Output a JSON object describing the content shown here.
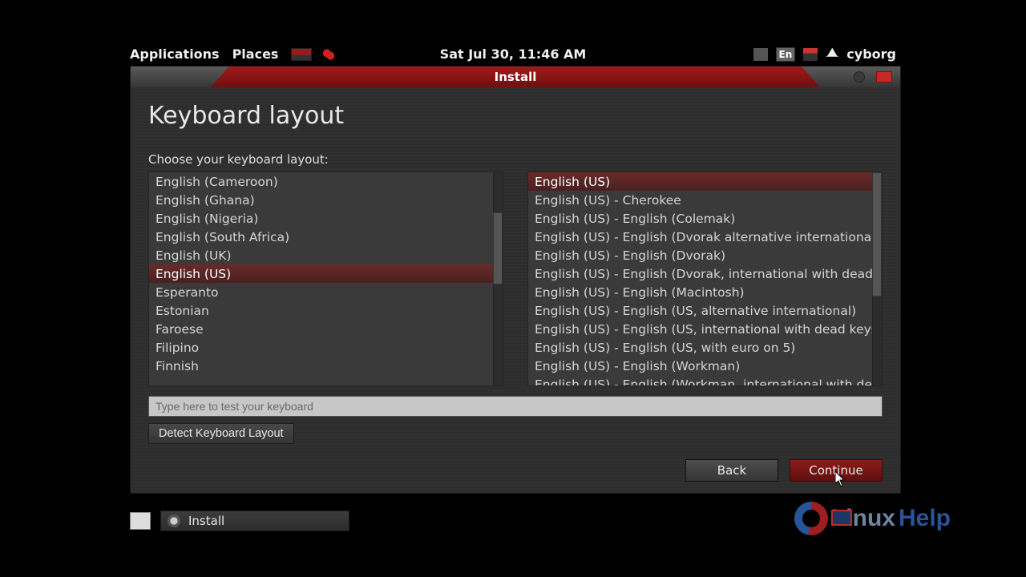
{
  "panel": {
    "menu_apps": "Applications",
    "menu_places": "Places",
    "clock": "Sat Jul 30, 11:46 AM",
    "lang_badge": "En",
    "user": "cyborg"
  },
  "window": {
    "title": "Install"
  },
  "page": {
    "title": "Keyboard layout",
    "choose_label": "Choose your keyboard layout:",
    "test_placeholder": "Type here to test your keyboard",
    "detect_label": "Detect Keyboard Layout",
    "back_label": "Back",
    "continue_label": "Continue"
  },
  "layouts_left": [
    {
      "label": "English (Cameroon)",
      "selected": false
    },
    {
      "label": "English (Ghana)",
      "selected": false
    },
    {
      "label": "English (Nigeria)",
      "selected": false
    },
    {
      "label": "English (South Africa)",
      "selected": false
    },
    {
      "label": "English (UK)",
      "selected": false
    },
    {
      "label": "English (US)",
      "selected": true
    },
    {
      "label": "Esperanto",
      "selected": false
    },
    {
      "label": "Estonian",
      "selected": false
    },
    {
      "label": "Faroese",
      "selected": false
    },
    {
      "label": "Filipino",
      "selected": false
    },
    {
      "label": "Finnish",
      "selected": false
    }
  ],
  "layouts_right": [
    {
      "label": "English (US)",
      "selected": true
    },
    {
      "label": "English (US) - Cherokee",
      "selected": false
    },
    {
      "label": "English (US) - English (Colemak)",
      "selected": false
    },
    {
      "label": "English (US) - English (Dvorak alternative international",
      "selected": false
    },
    {
      "label": "English (US) - English (Dvorak)",
      "selected": false
    },
    {
      "label": "English (US) - English (Dvorak, international with dead",
      "selected": false
    },
    {
      "label": "English (US) - English (Macintosh)",
      "selected": false
    },
    {
      "label": "English (US) - English (US, alternative international)",
      "selected": false
    },
    {
      "label": "English (US) - English (US, international with dead keys",
      "selected": false
    },
    {
      "label": "English (US) - English (US, with euro on 5)",
      "selected": false
    },
    {
      "label": "English (US) - English (Workman)",
      "selected": false
    },
    {
      "label": "English (US) - English (Workman, international with de",
      "selected": false
    }
  ],
  "taskbar": {
    "task_label": "Install"
  },
  "watermark": {
    "t1": "Linux",
    "t2": "Help"
  }
}
